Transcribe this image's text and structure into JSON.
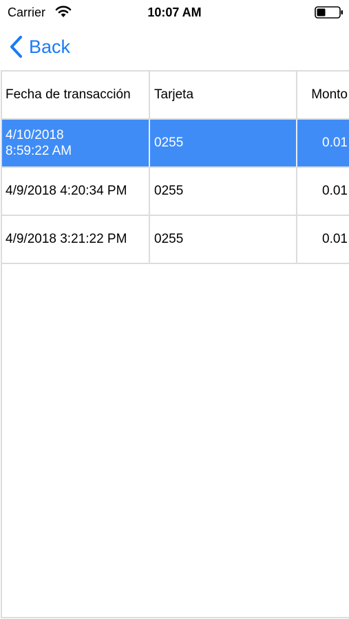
{
  "status_bar": {
    "carrier": "Carrier",
    "time": "10:07 AM",
    "wifi_icon": "wifi-icon",
    "battery_icon": "battery-icon"
  },
  "nav": {
    "back_label": "Back",
    "back_icon": "chevron-left-icon",
    "accent_color": "#1a7cf5"
  },
  "table": {
    "headers": {
      "fecha": "Fecha de transacción",
      "tarjeta": "Tarjeta",
      "monto": "Monto"
    },
    "selected_color": "#3f8cf7",
    "rows": [
      {
        "fecha_line1": "4/10/2018",
        "fecha_line2": "8:59:22 AM",
        "tarjeta": "0255",
        "monto": "0.01",
        "selected": true
      },
      {
        "fecha": "4/9/2018 4:20:34 PM",
        "tarjeta": "0255",
        "monto": "0.01",
        "selected": false
      },
      {
        "fecha": "4/9/2018 3:21:22 PM",
        "tarjeta": "0255",
        "monto": "0.01",
        "selected": false
      }
    ]
  }
}
